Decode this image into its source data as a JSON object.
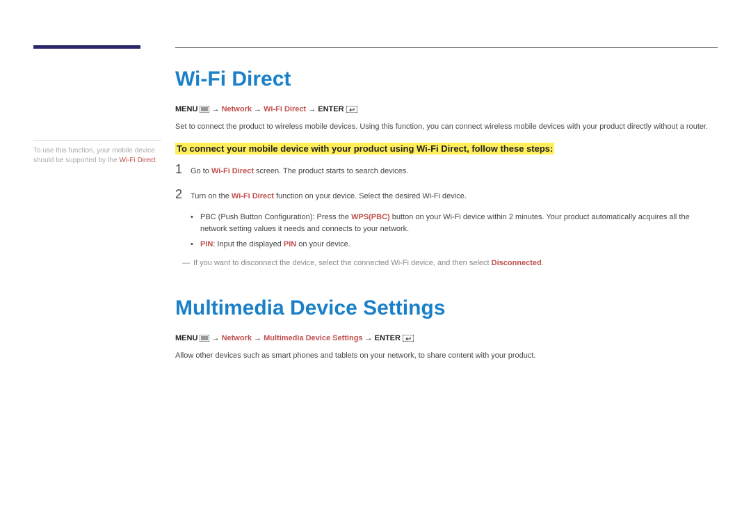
{
  "sidebar": {
    "note_prefix": "To use this function, your mobile device should be supported by the ",
    "note_bold": "Wi-Fi Direct",
    "note_suffix": "."
  },
  "section1": {
    "title": "Wi-Fi Direct",
    "crumb": {
      "menu": "MENU",
      "network": "Network",
      "item": "Wi-Fi Direct",
      "enter": "ENTER",
      "arrow": "→"
    },
    "desc": "Set to connect the product to wireless mobile devices. Using this function, you can connect wireless mobile devices with your product directly without a router.",
    "highlight": "To connect your mobile device with your product using Wi-Fi Direct, follow these steps:",
    "step1": {
      "num": "1",
      "pre": "Go to ",
      "bold": "Wi-Fi Direct",
      "post": " screen. The product starts to search devices."
    },
    "step2": {
      "num": "2",
      "pre": "Turn on the ",
      "bold": "Wi-Fi Direct",
      "post": " function on your device. Select the desired Wi-Fi device."
    },
    "bullet1": {
      "pre": "PBC (Push Button Configuration): Press the ",
      "bold": "WPS(PBC)",
      "post": " button on your Wi-Fi device within 2 minutes. Your product automatically acquires all the network setting values it needs and connects to your network."
    },
    "bullet2": {
      "bold1": "PIN",
      "mid": ": Input the displayed ",
      "bold2": "PIN",
      "post": " on your device."
    },
    "note": {
      "pre": "If you want to disconnect the device, select the connected Wi-Fi device, and then select ",
      "bold": "Disconnected",
      "post": "."
    }
  },
  "section2": {
    "title": "Multimedia Device Settings",
    "crumb": {
      "menu": "MENU",
      "network": "Network",
      "item": "Multimedia Device Settings",
      "enter": "ENTER",
      "arrow": "→"
    },
    "desc": "Allow other devices such as smart phones and tablets on your network, to share content with your product."
  }
}
